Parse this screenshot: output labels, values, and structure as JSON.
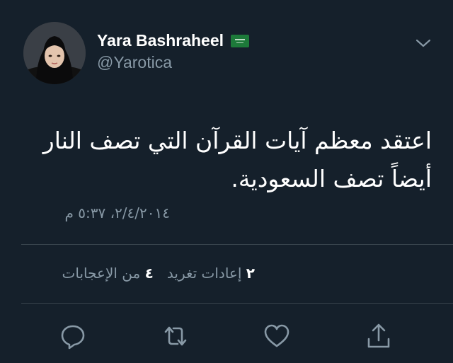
{
  "user": {
    "name": "Yara Bashraheel",
    "handle": "@Yarotica",
    "flag_icon": "saudi-flag-icon"
  },
  "tweet": {
    "lines": [
      "اعتقد معظم آيات القرآن التي تصف النار",
      "أيضاً تصف السعودية."
    ],
    "timestamp": "٢/٤/٢٠١٤، ٥:٣٧ م"
  },
  "stats": {
    "likes_count": "٤",
    "likes_label": "من الإعجابات",
    "retweets_count": "٢",
    "retweets_label": "إعادات تغريد"
  },
  "actions": [
    {
      "name": "reply",
      "icon": "reply-icon"
    },
    {
      "name": "retweet",
      "icon": "retweet-icon"
    },
    {
      "name": "like",
      "icon": "heart-icon"
    },
    {
      "name": "share",
      "icon": "share-icon"
    }
  ],
  "colors": {
    "background": "#15202b",
    "text": "#ffffff",
    "secondary_text": "#8899a6",
    "divider": "#38444d"
  }
}
